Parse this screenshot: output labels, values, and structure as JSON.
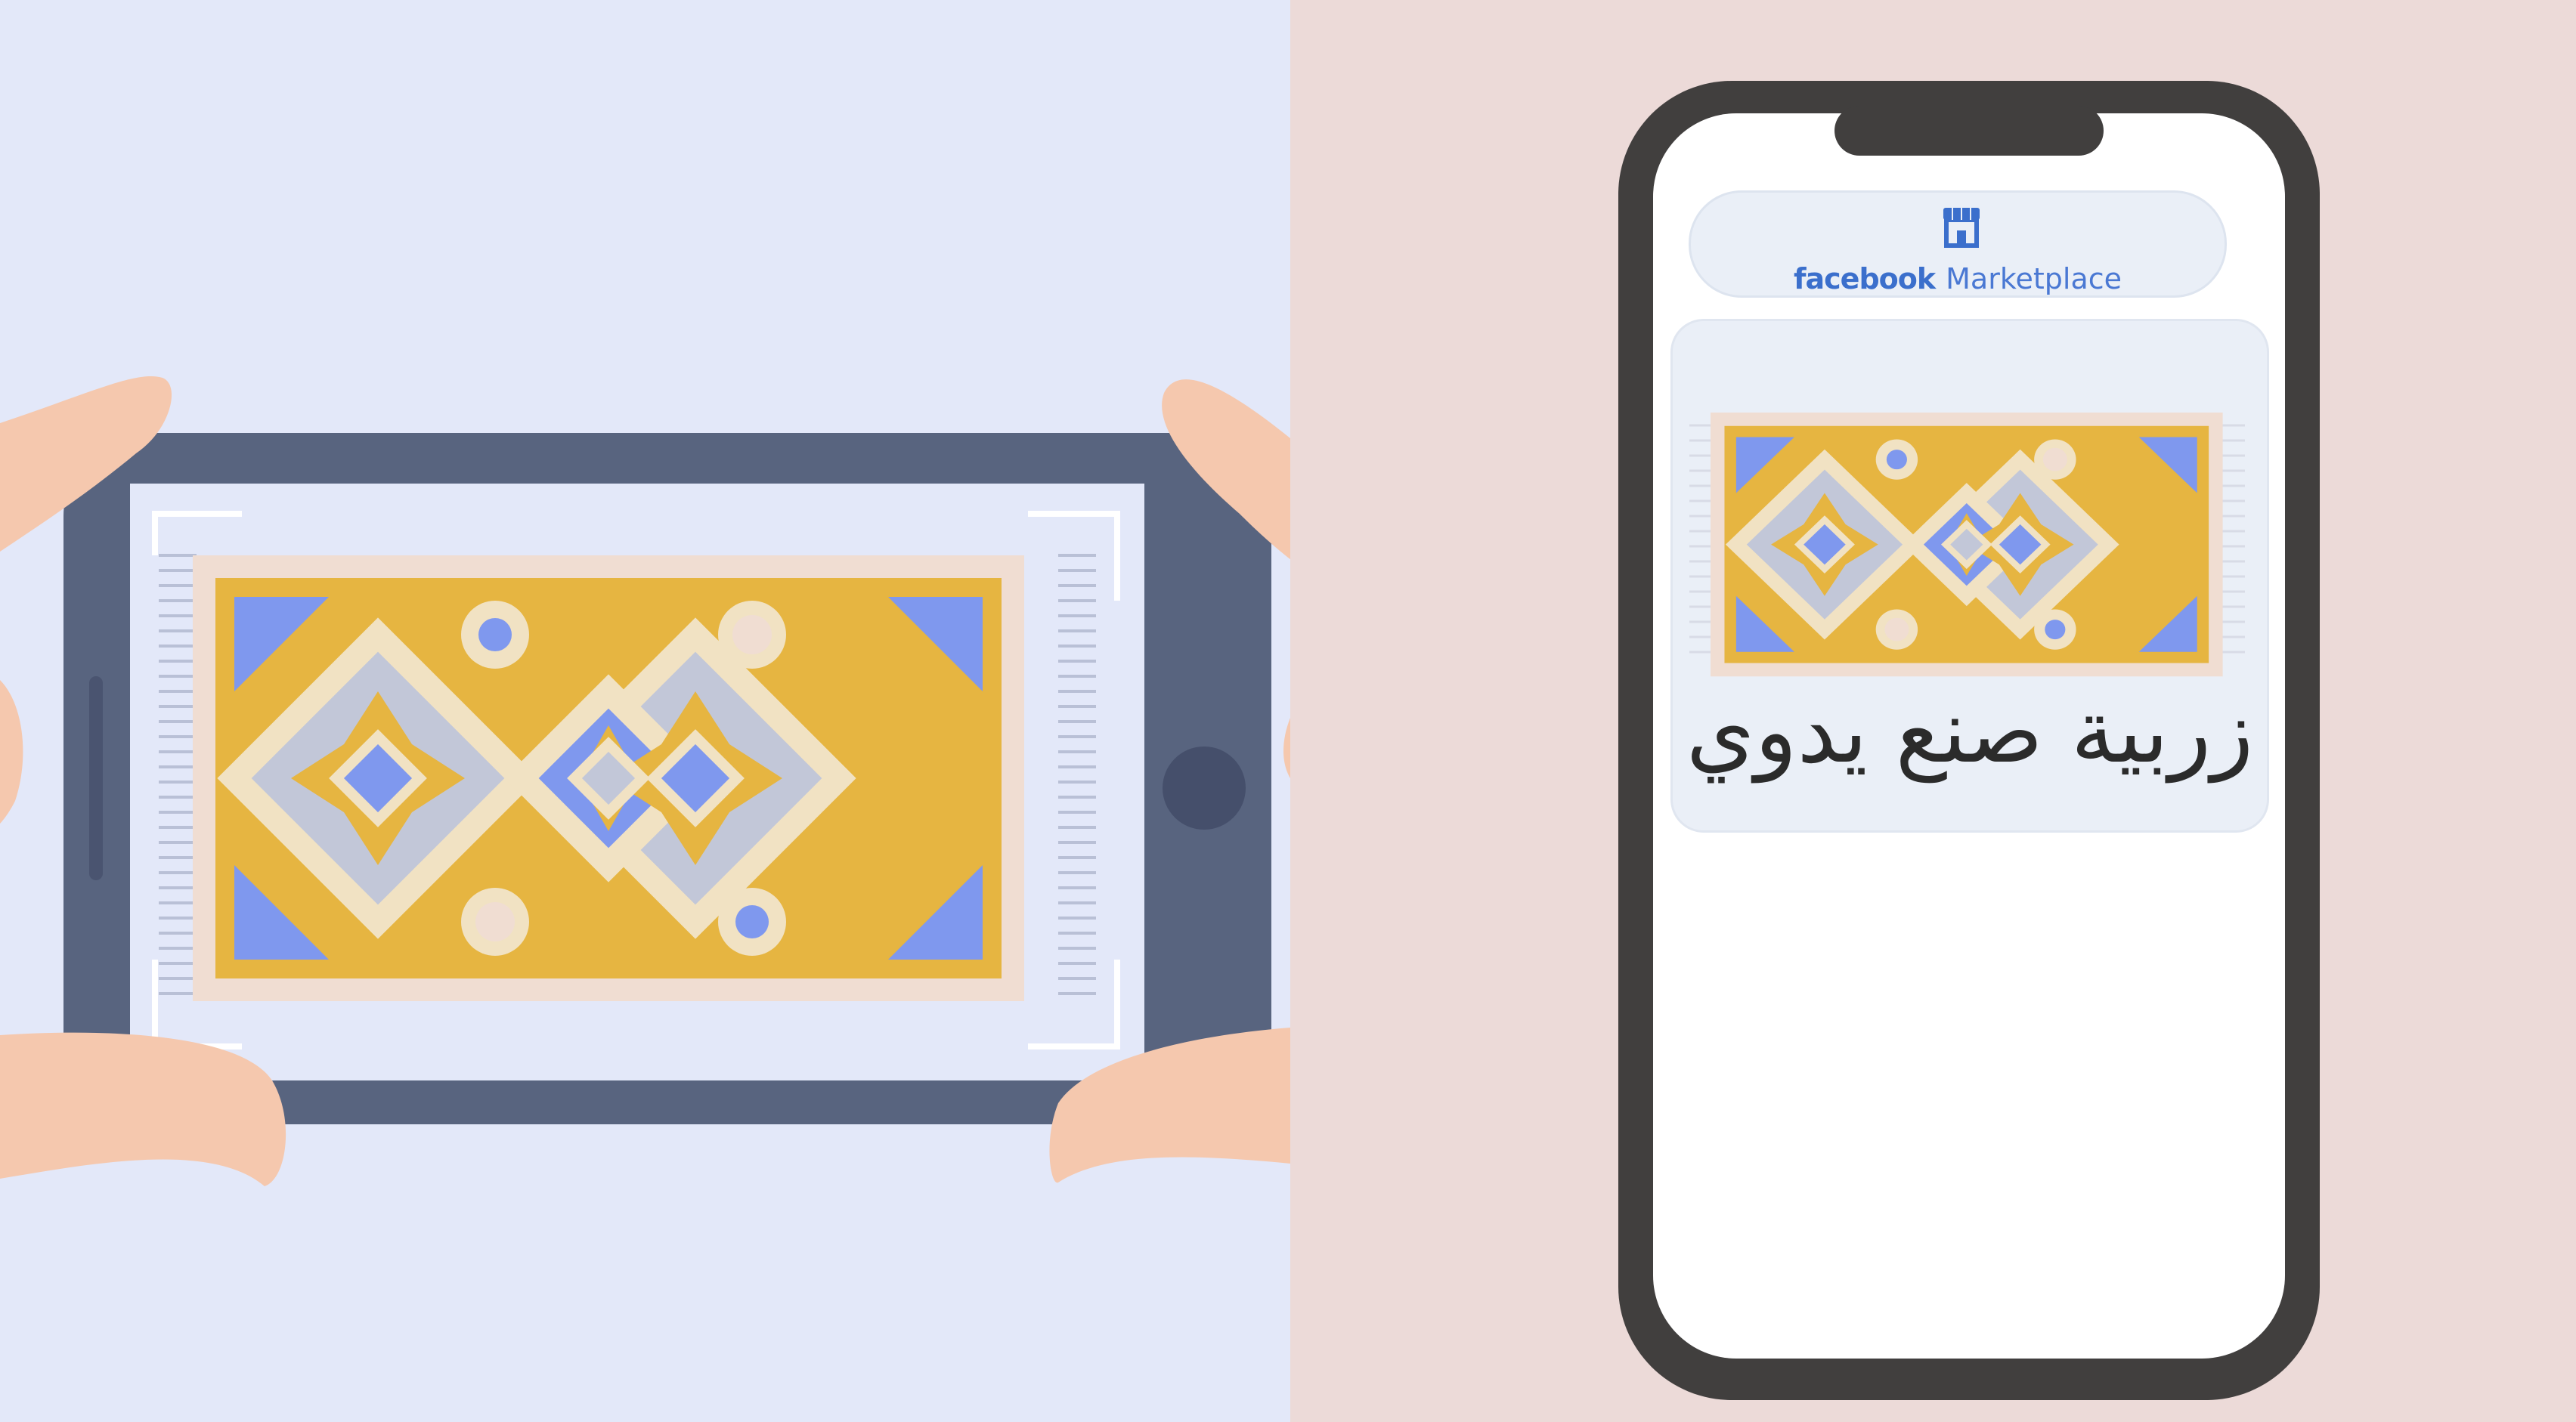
{
  "marketplace": {
    "brand_primary": "facebook",
    "brand_secondary": "Marketplace",
    "store_icon": "storefront-icon",
    "listing_title": "زربية صنع يدوي"
  },
  "colors": {
    "left_background": "#e3e8f9",
    "right_background": "#ecdad8",
    "phone_frame": "#58647f",
    "phone_dark_frame": "#413f3e",
    "rug_yellow": "#e6b541",
    "rug_blue": "#7f98ee",
    "rug_cream": "#f1e2c3",
    "rug_grey": "#c2c7d8",
    "skin": "#f5c8ae",
    "brand_blue": "#3b6fcc"
  }
}
